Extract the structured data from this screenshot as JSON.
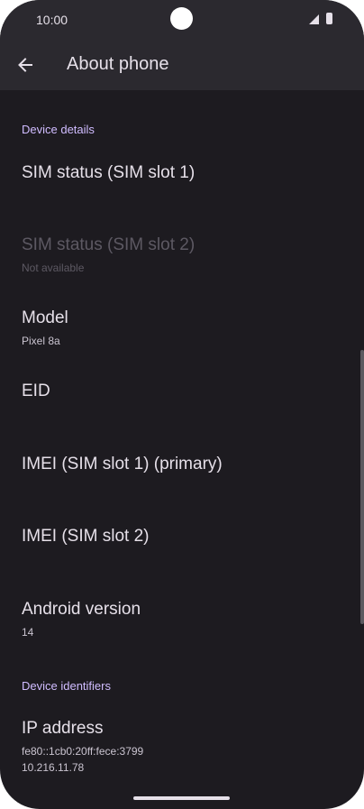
{
  "status_bar": {
    "time": "10:00",
    "icons": [
      "signal-icon",
      "battery-icon"
    ]
  },
  "toolbar": {
    "back_icon": "arrow-back-icon",
    "title": "About phone"
  },
  "sections": {
    "device_details": "Device details",
    "device_identifiers": "Device identifiers"
  },
  "items": {
    "sim_status_1": {
      "title": "SIM status (SIM slot 1)"
    },
    "sim_status_2": {
      "title": "SIM status (SIM slot 2)",
      "summary": "Not available"
    },
    "model": {
      "title": "Model",
      "summary": "Pixel 8a"
    },
    "eid": {
      "title": "EID"
    },
    "imei_1": {
      "title": "IMEI (SIM slot 1) (primary)"
    },
    "imei_2": {
      "title": "IMEI (SIM slot 2)"
    },
    "android_version": {
      "title": "Android version",
      "summary": "14"
    },
    "ip_address": {
      "title": "IP address",
      "summary_line1": "fe80::1cb0:20ff:fece:3799",
      "summary_line2": "10.216.11.78"
    }
  },
  "colors": {
    "background": "#1d1b20",
    "toolbar": "#2b292f",
    "accent": "#d0bcff",
    "text_primary": "#e6e0e9",
    "text_secondary": "#cac4d0",
    "text_disabled": "#5d5963"
  }
}
